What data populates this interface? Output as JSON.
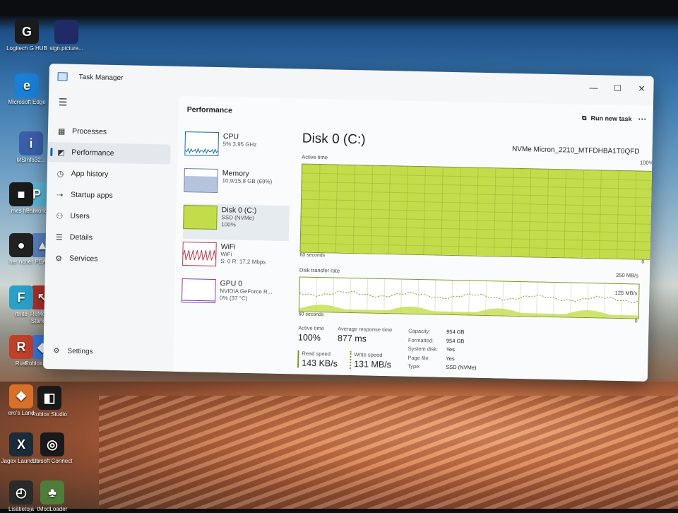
{
  "desktop": {
    "icons": [
      {
        "label": "Logitech G HUB",
        "glyph": "G",
        "color": "#1b1b1b"
      },
      {
        "label": "sign.picture...",
        "glyph": "",
        "color": "#1f2a66"
      },
      {
        "label": "Microsoft Edge",
        "glyph": "e",
        "color": "#1a7fd6"
      },
      {
        "label": "MSInfo32...",
        "glyph": "i",
        "color": "#3a5fa8"
      },
      {
        "label": "Palworld",
        "glyph": "P",
        "color": "#5ab8d8"
      },
      {
        "label": "PEAK",
        "glyph": "▲",
        "color": "#5c82c4"
      },
      {
        "label": "ReMouse Standard",
        "glyph": "↖",
        "color": "#b0302a"
      },
      {
        "label": "Roblox Player",
        "glyph": "◆",
        "color": "#3a78e0"
      },
      {
        "label": "Roblox Studio",
        "glyph": "◧",
        "color": "#1a1a1a"
      },
      {
        "label": "Jagex Launcher",
        "glyph": "X",
        "color": "#1b2b3a"
      },
      {
        "label": "Ubisoft Connect",
        "glyph": "◎",
        "color": "#1a1a1a"
      },
      {
        "label": "tModLoader",
        "glyph": "♣",
        "color": "#4e7d3a"
      },
      {
        "label": "Lisätietoja",
        "glyph": "◴",
        "color": "#2a2a2a"
      },
      {
        "label": "Rust",
        "glyph": "R",
        "color": "#c2402a"
      },
      {
        "label": "ero's Land",
        "glyph": "❖",
        "color": "#d8702a"
      },
      {
        "label": "rtnite",
        "glyph": "F",
        "color": "#2aa0c8"
      },
      {
        "label": "mes her",
        "glyph": "■",
        "color": "#1a1a1a"
      },
      {
        "label": "her ncher",
        "glyph": "●",
        "color": "#222"
      }
    ]
  },
  "window": {
    "title": "Task Manager",
    "controls": {
      "minimize": "—",
      "maximize": "☐",
      "close": "✕"
    }
  },
  "sidebar": {
    "items": [
      {
        "label": "Processes",
        "icon": "processes-icon",
        "glyph": "▦"
      },
      {
        "label": "Performance",
        "icon": "performance-icon",
        "glyph": "◩"
      },
      {
        "label": "App history",
        "icon": "app-history-icon",
        "glyph": "◷"
      },
      {
        "label": "Startup apps",
        "icon": "startup-apps-icon",
        "glyph": "⇢"
      },
      {
        "label": "Users",
        "icon": "users-icon",
        "glyph": "⚇"
      },
      {
        "label": "Details",
        "icon": "details-icon",
        "glyph": "☰"
      },
      {
        "label": "Services",
        "icon": "services-icon",
        "glyph": "⚙"
      }
    ],
    "settings_label": "Settings"
  },
  "header": {
    "title": "Performance",
    "run_new_task": "Run new task",
    "more": "···"
  },
  "devices": [
    {
      "name": "CPU",
      "sub1": "5% 3,95 GHz",
      "sub2": "",
      "color": "#1b6fb6",
      "fill": "#dbe9f6"
    },
    {
      "name": "Memory",
      "sub1": "10,9/15,8 GB (69%)",
      "sub2": "",
      "color": "#6e7fa8",
      "fill": "#b6c3dc"
    },
    {
      "name": "Disk 0 (C:)",
      "sub1": "SSD (NVMe)",
      "sub2": "100%",
      "color": "#7d9a2a",
      "fill": "#c3dd4a"
    },
    {
      "name": "WiFi",
      "sub1": "WiFi",
      "sub2": "S: 0 R: 17,2 Mbps",
      "color": "#b83a4a",
      "fill": "#f6dfe2"
    },
    {
      "name": "GPU 0",
      "sub1": "NVIDIA GeForce R...",
      "sub2": "0% (37 °C)",
      "color": "#7a3ab8",
      "fill": "#ffffff"
    }
  ],
  "detail": {
    "title": "Disk 0 (C:)",
    "model": "NVMe Micron_2210_MTFDHBA1T0QFD",
    "chart1": {
      "label": "Active time",
      "max_label": "100%",
      "time_label": "60 seconds",
      "min_label": "0",
      "value_percent": 100
    },
    "chart2": {
      "label": "Disk transfer rate",
      "max_label": "250 MB/s",
      "mid_label": "125 MB/s",
      "time_label": "60 seconds",
      "min_label": "0"
    },
    "stats": {
      "active_time_label": "Active time",
      "active_time_value": "100%",
      "avg_response_label": "Average response time",
      "avg_response_value": "877 ms",
      "read_label": "Read speed",
      "read_value": "143 KB/s",
      "write_label": "Write speed",
      "write_value": "131 MB/s"
    },
    "properties": [
      {
        "k": "Capacity:",
        "v": "954 GB"
      },
      {
        "k": "Formatted:",
        "v": "954 GB"
      },
      {
        "k": "System disk:",
        "v": "Yes"
      },
      {
        "k": "Page file:",
        "v": "Yes"
      },
      {
        "k": "Type:",
        "v": "SSD (NVMe)"
      }
    ]
  },
  "colors": {
    "accent": "#0a5fb4",
    "disk": "#c3dd4a",
    "disk_border": "#7d9a2a"
  }
}
